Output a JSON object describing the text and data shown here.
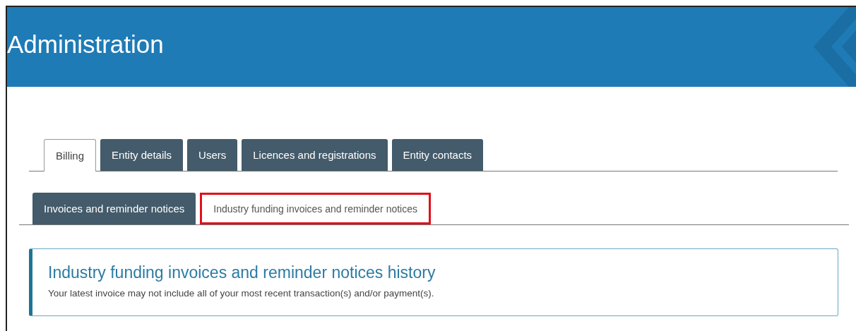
{
  "header": {
    "title": "Administration"
  },
  "tabs": [
    {
      "label": "Billing",
      "selected": true
    },
    {
      "label": "Entity details",
      "selected": false
    },
    {
      "label": "Users",
      "selected": false
    },
    {
      "label": "Licences and registrations",
      "selected": false
    },
    {
      "label": "Entity contacts",
      "selected": false
    }
  ],
  "subtabs": [
    {
      "label": "Invoices and reminder notices",
      "selected": false,
      "highlighted": false
    },
    {
      "label": "Industry funding invoices and reminder notices",
      "selected": true,
      "highlighted": true
    }
  ],
  "panel": {
    "title": "Industry funding invoices and reminder notices history",
    "note": "Your latest invoice may not include all of your most recent transaction(s) and/or payment(s)."
  }
}
